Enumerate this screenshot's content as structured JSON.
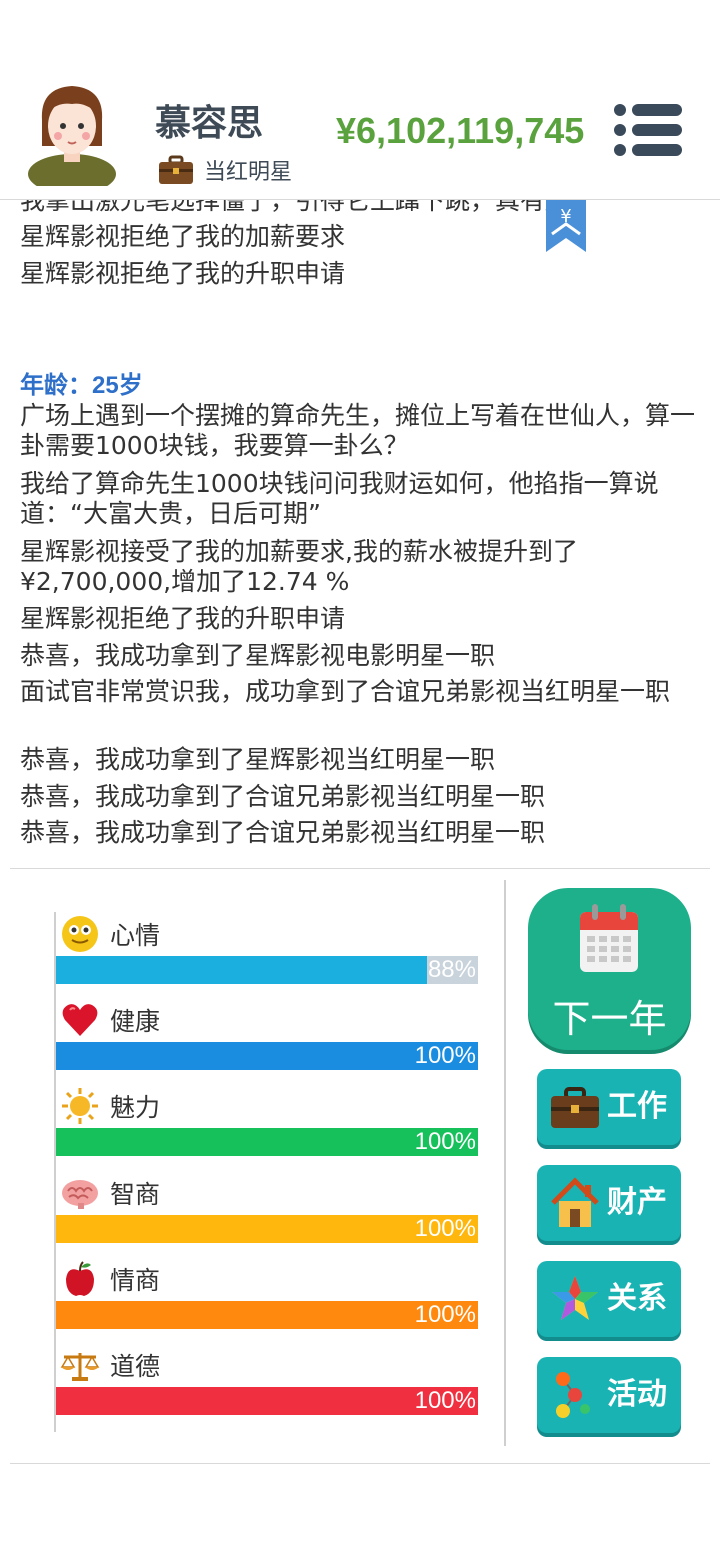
{
  "header": {
    "name": "慕容思",
    "job_title": "当红明星",
    "money": "¥6,102,119,745"
  },
  "log": {
    "partial_line": "我拿出激光笔选择僵了，引得它上蹿下跳，真有趣",
    "lines_before": [
      "星辉影视拒绝了我的加薪要求",
      "星辉影视拒绝了我的升职申请"
    ],
    "age_label": "年龄：25岁",
    "lines_after": [
      "广场上遇到一个摆摊的算命先生，摊位上写着在世仙人，算一卦需要1000块钱，我要算一卦么？",
      "我给了算命先生1000块钱问问我财运如何，他掐指一算说道：“大富大贵，日后可期”",
      "星辉影视接受了我的加薪要求,我的薪水被提升到了¥2,700,000,增加了12.74 %",
      "星辉影视拒绝了我的升职申请",
      "恭喜，我成功拿到了星辉影视电影明星一职",
      "面试官非常赏识我，成功拿到了合谊兄弟影视当红明星一职",
      "恭喜，我成功拿到了星辉影视当红明星一职",
      "恭喜，我成功拿到了合谊兄弟影视当红明星一职",
      "恭喜，我成功拿到了合谊兄弟影视当红明星一职"
    ],
    "bookmark_symbol": "¥"
  },
  "stats": [
    {
      "label": "心情",
      "value_text": "88%",
      "value": 88,
      "color": "#1bafe0",
      "icon": "smiley-icon"
    },
    {
      "label": "健康",
      "value_text": "100%",
      "value": 100,
      "color": "#1a8de0",
      "icon": "heart-icon"
    },
    {
      "label": "魅力",
      "value_text": "100%",
      "value": 100,
      "color": "#16c05a",
      "icon": "sun-icon"
    },
    {
      "label": "智商",
      "value_text": "100%",
      "value": 100,
      "color": "#ffb60d",
      "icon": "brain-icon"
    },
    {
      "label": "情商",
      "value_text": "100%",
      "value": 100,
      "color": "#ff880e",
      "icon": "apple-icon"
    },
    {
      "label": "道德",
      "value_text": "100%",
      "value": 100,
      "color": "#f03040",
      "icon": "scale-icon"
    }
  ],
  "buttons": {
    "next_year": "下一年",
    "work": "工作",
    "property": "财产",
    "relations": "关系",
    "activities": "活动"
  },
  "colors": {
    "money": "#5aa23e",
    "age": "#2d6fc9",
    "next_button": "#1db08a",
    "side_button": "#19b3b3"
  }
}
